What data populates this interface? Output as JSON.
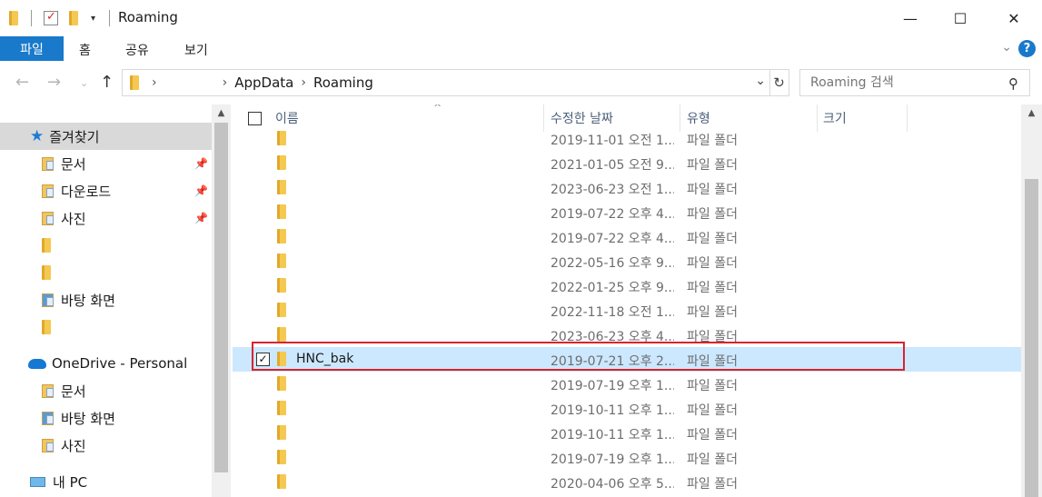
{
  "window": {
    "title": "Roaming",
    "minimize_glyph": "—",
    "maximize_glyph": "☐",
    "close_glyph": "✕"
  },
  "ribbon": {
    "file_tab": "파일",
    "tabs": [
      "홈",
      "공유",
      "보기"
    ],
    "help_glyph": "?"
  },
  "address": {
    "breadcrumbs": [
      "AppData",
      "Roaming"
    ],
    "search_placeholder": "Roaming 검색"
  },
  "navpane": {
    "quick_access": "즐겨찾기",
    "quick_items": [
      "문서",
      "다운로드",
      "사진",
      "",
      "",
      "바탕 화면",
      ""
    ],
    "onedrive": "OneDrive - Personal",
    "onedrive_items": [
      "문서",
      "바탕 화면",
      "사진"
    ],
    "this_pc": "내 PC"
  },
  "columns": {
    "name": "이름",
    "date": "수정한 날짜",
    "type": "유형",
    "size": "크기"
  },
  "rows": [
    {
      "name": "",
      "date": "2019-11-01 오전 1...",
      "type": "파일 폴더"
    },
    {
      "name": "",
      "date": "2021-01-05 오전 9...",
      "type": "파일 폴더"
    },
    {
      "name": "",
      "date": "2023-06-23 오전 1...",
      "type": "파일 폴더"
    },
    {
      "name": "",
      "date": "2019-07-22 오후 4...",
      "type": "파일 폴더"
    },
    {
      "name": "",
      "date": "2019-07-22 오후 4...",
      "type": "파일 폴더"
    },
    {
      "name": "",
      "date": "2022-05-16 오후 9...",
      "type": "파일 폴더"
    },
    {
      "name": "",
      "date": "2022-01-25 오후 9...",
      "type": "파일 폴더"
    },
    {
      "name": "",
      "date": "2022-11-18 오전 1...",
      "type": "파일 폴더"
    },
    {
      "name": "",
      "date": "2023-06-23 오후 4...",
      "type": "파일 폴더"
    },
    {
      "name": "HNC_bak",
      "date": "2019-07-21 오후 2...",
      "type": "파일 폴더",
      "selected": true
    },
    {
      "name": "",
      "date": "2019-07-19 오후 1...",
      "type": "파일 폴더"
    },
    {
      "name": "",
      "date": "2019-10-11 오후 1...",
      "type": "파일 폴더"
    },
    {
      "name": "",
      "date": "2019-10-11 오후 1...",
      "type": "파일 폴더"
    },
    {
      "name": "",
      "date": "2019-07-19 오후 1...",
      "type": "파일 폴더"
    },
    {
      "name": "",
      "date": "2020-04-06 오후 5...",
      "type": "파일 폴더"
    }
  ],
  "colors": {
    "accent": "#1979ca",
    "selection": "#cce8ff",
    "highlight_border": "#d9232e"
  }
}
